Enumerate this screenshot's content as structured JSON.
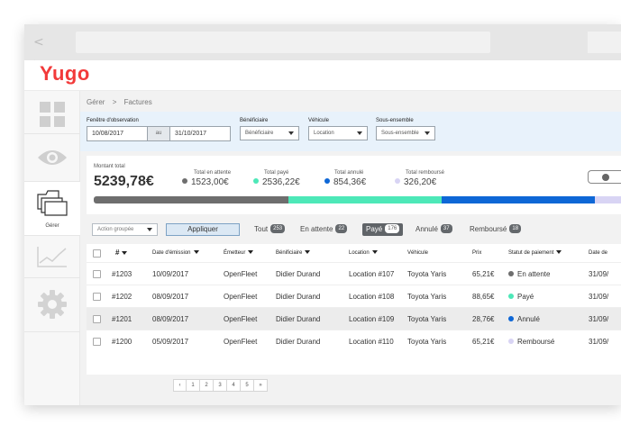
{
  "app": {
    "logo": "Yugo"
  },
  "browser": {
    "nav_arrows": "< >"
  },
  "sidebar": {
    "items": [
      {
        "icon": "grid-icon"
      },
      {
        "icon": "eye-icon"
      },
      {
        "icon": "folders-icon",
        "label": "Gérer"
      },
      {
        "icon": "chart-icon"
      },
      {
        "icon": "gear-icon"
      }
    ]
  },
  "breadcrumb": {
    "parent": "Gérer",
    "separator": ">",
    "current": "Factures"
  },
  "filters": {
    "window_label": "Fenêtre d'observation",
    "date_from": "10/08/2017",
    "date_sep": "au",
    "date_to": "31/10/2017",
    "beneficiary_label": "Bénéficiaire",
    "beneficiary_value": "Bénéficiaire",
    "vehicle_label": "Véhicule",
    "vehicle_value": "Location",
    "subset_label": "Sous-ensemble",
    "subset_value": "Sous-ensemble"
  },
  "totals": {
    "total_label": "Montant total",
    "total_value": "5239,78€",
    "items": [
      {
        "label": "Total en attente",
        "value": "1523,00€",
        "color": "#6e6e6e"
      },
      {
        "label": "Total payé",
        "value": "2536,22€",
        "color": "#4de8b8"
      },
      {
        "label": "Total annulé",
        "value": "854,36€",
        "color": "#0e67d6"
      },
      {
        "label": "Total remboursé",
        "value": "326,20€",
        "color": "#d8d4f4"
      }
    ],
    "bar_fractions": [
      0.37,
      0.29,
      0.29,
      0.05
    ]
  },
  "toolbar": {
    "bulk_action": "Action groupée",
    "apply": "Appliquer",
    "filters": [
      {
        "label": "Tout",
        "count": "253"
      },
      {
        "label": "En attente",
        "count": "22"
      },
      {
        "label": "Payé",
        "count": "176"
      },
      {
        "label": "Annulé",
        "count": "37"
      },
      {
        "label": "Remboursé",
        "count": "18"
      }
    ]
  },
  "table": {
    "headers": [
      "#",
      "Date d'émission",
      "Émetteur",
      "Bénificiaire",
      "Location",
      "Véhicule",
      "Prix",
      "Statut de paiement",
      "Date de"
    ],
    "rows": [
      {
        "id": "#1203",
        "date": "10/09/2017",
        "issuer": "OpenFleet",
        "beneficiary": "Didier Durand",
        "location": "Location #107",
        "vehicle": "Toyota Yaris",
        "price": "65,21€",
        "status": "En attente",
        "status_color": "#6e6e6e",
        "date2": "31/09/"
      },
      {
        "id": "#1202",
        "date": "08/09/2017",
        "issuer": "OpenFleet",
        "beneficiary": "Didier Durand",
        "location": "Location #108",
        "vehicle": "Toyota Yaris",
        "price": "88,65€",
        "status": "Payé",
        "status_color": "#4de8b8",
        "date2": "31/09/"
      },
      {
        "id": "#1201",
        "date": "08/09/2017",
        "issuer": "OpenFleet",
        "beneficiary": "Didier Durand",
        "location": "Location #109",
        "vehicle": "Toyota Yaris",
        "price": "28,76€",
        "status": "Annulé",
        "status_color": "#0e67d6",
        "date2": "31/09/"
      },
      {
        "id": "#1200",
        "date": "05/09/2017",
        "issuer": "OpenFleet",
        "beneficiary": "Didier Durand",
        "location": "Location #110",
        "vehicle": "Toyota Yaris",
        "price": "65,21€",
        "status": "Remboursé",
        "status_color": "#d8d4f4",
        "date2": "31/09/"
      }
    ]
  },
  "pagination": {
    "prev": "‹",
    "pages": [
      "1",
      "2",
      "3",
      "4",
      "5"
    ],
    "next": "»"
  }
}
